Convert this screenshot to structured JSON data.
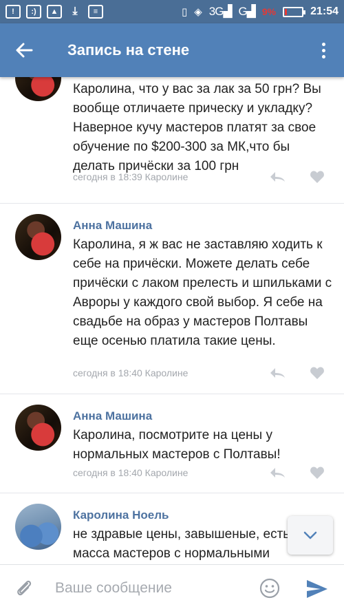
{
  "status": {
    "network_3g": "3G",
    "network_g": "G",
    "battery_pct": "9%",
    "time": "21:54"
  },
  "header": {
    "title": "Запись на стене"
  },
  "comments": [
    {
      "author": "",
      "text": "Каролина, что у вас за лак за 50 грн? Вы вообще отличаете прическу и укладку? Наверное кучу мастеров платят за свое обучение по $200-300 за МК,что бы делать причёски за 100 грн",
      "meta": "сегодня в 18:39 Каролине"
    },
    {
      "author": "Анна Машина",
      "text": "Каролина, я ж вас не заставляю ходить к себе на причёски. Можете делать себе причёски с лаком прелесть и шпильками с Авроры у каждого свой выбор. Я себе на свадьбе на образ у мастеров Полтавы еще осенью платила такие цены.",
      "meta": "сегодня в 18:40 Каролине"
    },
    {
      "author": "Анна Машина",
      "text": "Каролина, посмотрите на цены у нормальных мастеров с Полтавы!",
      "meta": "сегодня в 18:40 Каролине"
    },
    {
      "author": "Каролина Ноель",
      "text": "не здравые цены, завышеные, есть масса мастеров с нормальными",
      "meta": ""
    }
  ],
  "composer": {
    "placeholder": "Ваше сообщение"
  },
  "colors": {
    "status_bar": "#4a6e96",
    "app_bar": "#5181b8",
    "author": "#4d72a0",
    "meta": "#a3a7ad",
    "send": "#5181b8"
  },
  "icons": {
    "back": "arrow-left-icon",
    "more": "more-vertical-icon",
    "reply": "reply-icon",
    "like": "heart-icon",
    "attach": "paperclip-icon",
    "emoji": "smile-icon",
    "send": "send-icon",
    "scroll": "chevron-down-icon"
  }
}
